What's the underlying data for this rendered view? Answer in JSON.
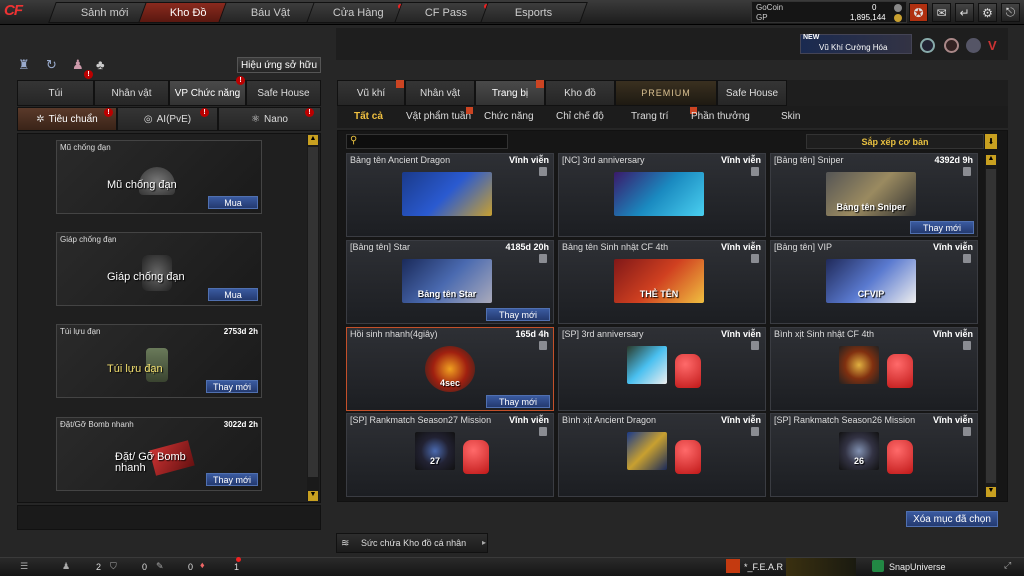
{
  "topnav": [
    "Sảnh mới",
    "Kho Đồ",
    "Báu Vật",
    "Cửa Hàng",
    "CF Pass",
    "Esports"
  ],
  "currency": {
    "gocoin_label": "GoCoin",
    "gocoin_value": "0",
    "gp_label": "GP",
    "gp_value": "1,895,144"
  },
  "promo": {
    "badge": "NEW",
    "text": "Vũ Khí Cường Hóa"
  },
  "left": {
    "effect_button": "Hiệu ứng sở hữu",
    "tabs": [
      "Túi",
      "Nhân vật",
      "VP Chức năng",
      "Safe House"
    ],
    "subtabs": [
      "Tiêu chuẩn",
      "AI(PvE)",
      "Nano"
    ],
    "cards": [
      {
        "title": "Mũ chống đạn",
        "duration": "",
        "caption": "Mũ chống đạn",
        "button": "Mua"
      },
      {
        "title": "Giáp chống đạn",
        "duration": "",
        "caption": "Giáp chống đạn",
        "button": "Mua"
      },
      {
        "title": "Túi lựu đạn",
        "duration": "2753d 2h",
        "caption": "Túi lựu đạn",
        "button": "Thay mới"
      },
      {
        "title": "Đặt/Gỡ Bomb nhanh",
        "duration": "3022d 2h",
        "caption": "Đặt/ Gỡ Bomb nhanh",
        "button": "Thay mới"
      }
    ]
  },
  "right": {
    "tabs": [
      "Vũ khí",
      "Nhân vật",
      "Trang bị",
      "Kho đồ",
      "PREMIUM",
      "Safe House"
    ],
    "subtabs": [
      "Tất cả",
      "Vật phẩm tuần",
      "Chức năng",
      "Chỉ chế độ",
      "Trang trí",
      "Phần thưởng",
      "Skin"
    ],
    "sort_label": "Sắp xếp cơ bản",
    "items": [
      {
        "title": "Bảng tên Ancient Dragon",
        "duration": "Vĩnh viễn",
        "art": "",
        "button": ""
      },
      {
        "title": "[NC] 3rd anniversary",
        "duration": "Vĩnh viễn",
        "art": "",
        "button": ""
      },
      {
        "title": "[Bảng tên] Sniper",
        "duration": "4392d 9h",
        "art": "Bảng tên Sniper",
        "button": "Thay mới"
      },
      {
        "title": "[Bảng tên] Star",
        "duration": "4185d 20h",
        "art": "Bảng tên Star",
        "button": "Thay mới"
      },
      {
        "title": "Bảng tên Sinh nhật CF 4th",
        "duration": "Vĩnh viễn",
        "art": "THẺ TÊN",
        "button": ""
      },
      {
        "title": "[Bảng tên] VIP",
        "duration": "Vĩnh viễn",
        "art": "CFVIP",
        "button": ""
      },
      {
        "title": "Hồi sinh nhanh(4giây)",
        "duration": "165d 4h",
        "art": "4sec",
        "button": "Thay mới"
      },
      {
        "title": "[SP] 3rd anniversary",
        "duration": "Vĩnh viễn",
        "art": "",
        "button": ""
      },
      {
        "title": "Bình xịt Sinh nhật CF 4th",
        "duration": "Vĩnh viễn",
        "art": "",
        "button": ""
      },
      {
        "title": "[SP] Rankmatch Season27 Mission",
        "duration": "Vĩnh viễn",
        "art": "27",
        "button": ""
      },
      {
        "title": "Bình xịt Ancient Dragon",
        "duration": "Vĩnh viễn",
        "art": "",
        "button": ""
      },
      {
        "title": "[SP] Rankmatch Season26 Mission",
        "duration": "Vĩnh viễn",
        "art": "26",
        "button": ""
      }
    ],
    "clear_button": "Xóa mục đã chọn",
    "repair_label": "Sức chứa Kho đồ cá nhân"
  },
  "bottom": {
    "count1": "2",
    "count2": "0",
    "count3": "0",
    "count4": "1",
    "user": "*_F.E.A.R",
    "clan": "SnapUniverse"
  }
}
